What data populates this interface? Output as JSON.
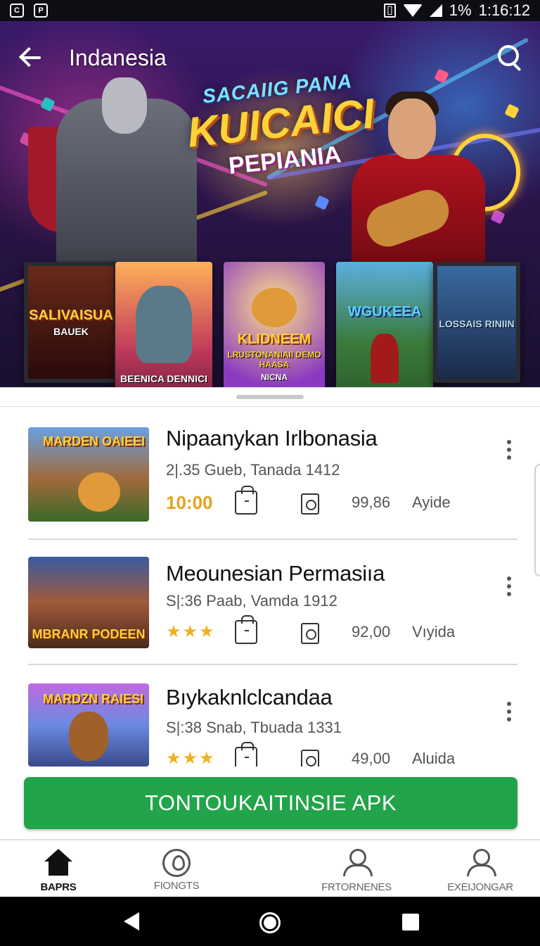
{
  "status_bar": {
    "left_icons": [
      "notification-c-icon",
      "notification-p-icon"
    ],
    "battery": "1%",
    "time": "1:16:12"
  },
  "app_bar": {
    "title": "Indanesia",
    "icons": [
      "back-arrow-icon",
      "search-icon"
    ]
  },
  "hero": {
    "tagline": "SACAIIG PANA",
    "headline": "KUICAICI",
    "subhead": "PEPIANIA",
    "cards": [
      {
        "title": "SALIVAISUA",
        "subtitle": "BAUEK"
      },
      {
        "title": "",
        "subtitle": "BEENICA DENNICI"
      },
      {
        "title": "KLIDNEEM",
        "subtitle": "LRUSTONANIAII DEMO HAASA",
        "footer": "NICNA"
      },
      {
        "title": "WGUKEEA",
        "subtitle": ""
      },
      {
        "title": "",
        "subtitle": "LOSSAIS RINIIN"
      }
    ]
  },
  "games": [
    {
      "title": "Nipaanykan Irlbonasia",
      "meta": "2|.35 Gueb,  Tanada 1412",
      "time": "10:00",
      "rating_stars": null,
      "score": "99,86",
      "size": "Ayide",
      "thumb_text": "MARDEN OAIEEI"
    },
    {
      "title": "Meounesian Permasiıa",
      "meta": "S|:36 Paab,  Vamda 1912",
      "time": null,
      "rating_stars": "★★★",
      "score": "92,00",
      "size": "Vıyida",
      "thumb_text": "MBRANR PODEEN"
    },
    {
      "title": "Bıykaknlclcandaa",
      "meta": "S|:38 Snab,  Tbuada 1331",
      "time": null,
      "rating_stars": "★★★",
      "score": "49,00",
      "size": "Aluida",
      "thumb_text": "MARDZN RAIESI"
    }
  ],
  "cta": {
    "label": "TONTOUKAITINSIE APK"
  },
  "bottom_nav": [
    {
      "label": "BAPRS",
      "icon": "home-icon",
      "active": true
    },
    {
      "label": "FIONGTS",
      "icon": "location-pin-icon",
      "active": false
    },
    {
      "label": "FRTORNENES",
      "icon": "user-edit-icon",
      "active": false
    },
    {
      "label": "EXEIJONGAR",
      "icon": "user-icon",
      "active": false
    }
  ],
  "colors": {
    "accent_green": "#22a44a",
    "time_orange": "#e7a21a",
    "star_gold": "#f0b020"
  }
}
